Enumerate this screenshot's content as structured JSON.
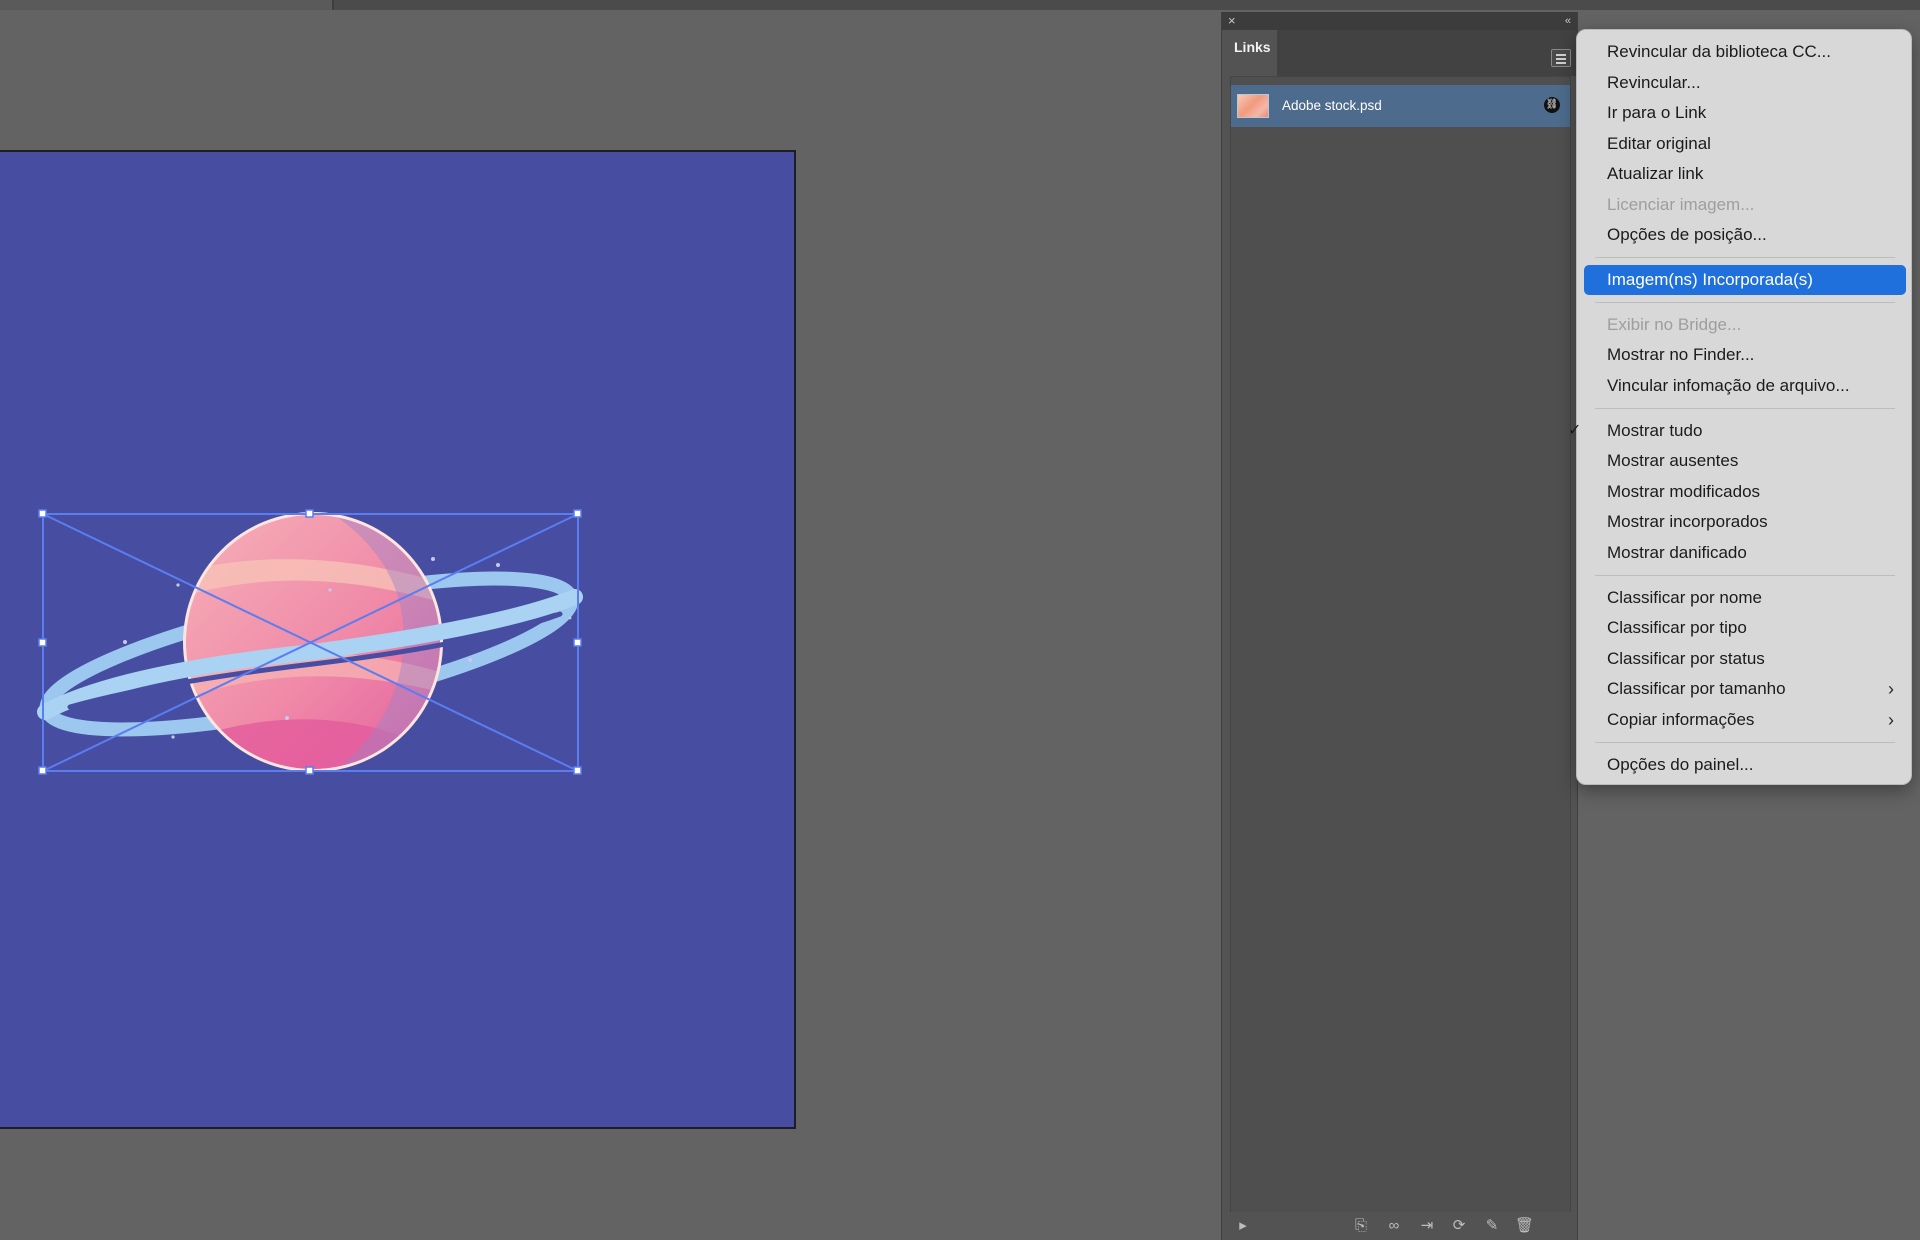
{
  "links_panel": {
    "tab_label": "Links",
    "close_glyph": "×",
    "collapse_glyph": "«",
    "items": [
      {
        "name": "Adobe stock.psd",
        "status_icon": "link-icon"
      }
    ],
    "footer_icons": [
      "expand-arrow-icon",
      "relink-cc-icon",
      "relink-icon",
      "goto-link-icon",
      "update-link-icon",
      "edit-original-icon",
      "trash-icon"
    ]
  },
  "context_menu": {
    "items": [
      {
        "label": "Revincular da biblioteca CC..."
      },
      {
        "label": "Revincular..."
      },
      {
        "label": "Ir para o Link"
      },
      {
        "label": "Editar original"
      },
      {
        "label": "Atualizar link"
      },
      {
        "label": "Licenciar imagem..."
      },
      {
        "label": "Opções de posição..."
      },
      {
        "label": "Imagem(ns) Incorporada(s)"
      },
      {
        "label": "Exibir no Bridge..."
      },
      {
        "label": "Mostrar no Finder..."
      },
      {
        "label": "Vincular infomação de arquivo..."
      },
      {
        "label": "Mostrar tudo"
      },
      {
        "label": "Mostrar ausentes"
      },
      {
        "label": "Mostrar modificados"
      },
      {
        "label": "Mostrar incorporados"
      },
      {
        "label": "Mostrar danificado"
      },
      {
        "label": "Classificar por nome"
      },
      {
        "label": "Classificar por tipo"
      },
      {
        "label": "Classificar por status"
      },
      {
        "label": "Classificar por tamanho"
      },
      {
        "label": "Copiar informações"
      },
      {
        "label": "Opções do painel..."
      }
    ],
    "check_glyph": "✓",
    "submenu_glyph": "›"
  },
  "colors": {
    "artboard": "#474ea2",
    "selection": "#5a7df0",
    "menu_highlight": "#1f6fdd",
    "link_row_selected": "#4d6b8c"
  }
}
